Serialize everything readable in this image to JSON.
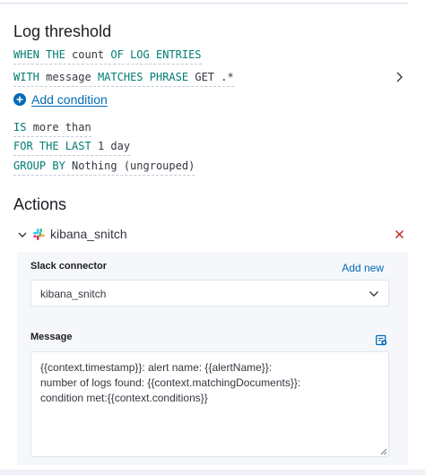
{
  "log_threshold": {
    "title": "Log threshold",
    "when": {
      "keyword": "WHEN THE",
      "value": "count",
      "keyword2": "OF LOG ENTRIES"
    },
    "with": {
      "keyword": "WITH",
      "field": "message",
      "operator": "MATCHES PHRASE",
      "value": "GET .*"
    },
    "add_condition_label": "Add condition",
    "is": {
      "keyword": "IS",
      "value": "more than"
    },
    "for_the_last": {
      "keyword": "FOR THE LAST",
      "value": "1 day"
    },
    "group_by": {
      "keyword": "GROUP BY",
      "value": "Nothing (ungrouped)"
    }
  },
  "actions": {
    "title": "Actions",
    "items": [
      {
        "name": "kibana_snitch",
        "icon": "slack-icon",
        "connector_label": "Slack connector",
        "add_new_label": "Add new",
        "connector_value": "kibana_snitch",
        "message_label": "Message",
        "message_lines": [
          "{{context.timestamp}}: alert name: {{alertName}}:",
          "number of logs found: {{context.matchingDocuments}}:",
          "condition met:{{context.conditions}}"
        ]
      }
    ]
  },
  "colors": {
    "keyword": "#017d73",
    "link": "#006bb8",
    "danger": "#bd271e",
    "panel": "#f5f7fa"
  }
}
